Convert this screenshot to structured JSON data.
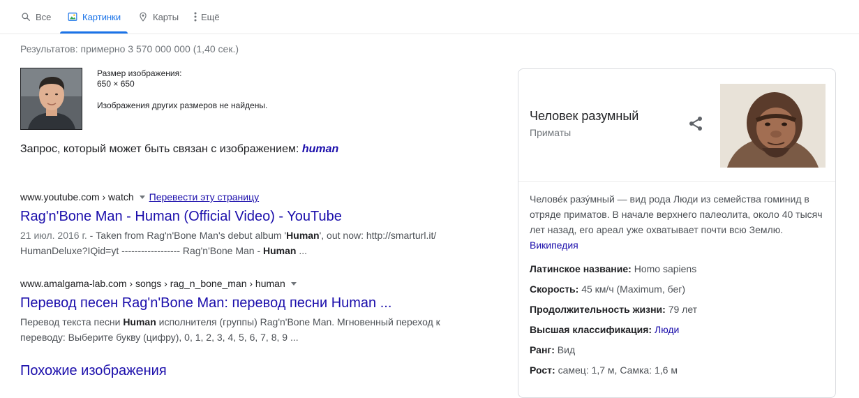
{
  "tabs": [
    {
      "label": "Все",
      "icon": "search-icon"
    },
    {
      "label": "Картинки",
      "icon": "image-icon",
      "active": true
    },
    {
      "label": "Карты",
      "icon": "map-pin-icon"
    },
    {
      "label": "Ещё",
      "icon": "more-vert-icon"
    }
  ],
  "stats": "Результатов: примерно 3 570 000 000 (1,40 сек.)",
  "image_info": {
    "size_label": "Размер изображения:",
    "size_value": "650 × 650",
    "not_found": "Изображения других размеров не найдены."
  },
  "query": {
    "prefix": "Запрос, который может быть связан с изображением: ",
    "term": "human"
  },
  "results": [
    {
      "url": "www.youtube.com › watch",
      "translate": "Перевести эту страницу",
      "title": "Rag'n'Bone Man - Human (Official Video) - YouTube",
      "date": "21 июл. 2016 г.",
      "snippet_a": " - Taken from Rag'n'Bone Man's debut album '",
      "snippet_b": "Human",
      "snippet_c": "', out now: http://smarturl.it/ HumanDeluxe?IQid=yt ------------------ Rag'n'Bone Man - ",
      "snippet_d": "Human",
      "snippet_e": " ..."
    },
    {
      "url": "www.amalgama-lab.com › songs › rag_n_bone_man › human",
      "title": "Перевод песен Rag'n'Bone Man: перевод песни Human ...",
      "snippet_a": "Перевод текста песни ",
      "snippet_b": "Human",
      "snippet_c": " исполнителя (группы) Rag'n'Bone Man. Мгновенный переход к переводу: Выберите букву (цифру), 0, 1, 2, 3, 4, 5, 6, 7, 8, 9 ..."
    }
  ],
  "similar": "Похожие изображения",
  "knowledge_panel": {
    "title": "Человек разумный",
    "subtitle": "Приматы",
    "description": "Челове́к разу́мный — вид рода Люди из семейства гоминид в отряде приматов. В начале верхнего палеолита, около 40 тысяч лет назад, его ареал уже охватывает почти всю Землю.",
    "source": "Википедия",
    "facts": [
      {
        "label": "Латинское название:",
        "value": "Homo sapiens"
      },
      {
        "label": "Скорость:",
        "value": "45 км/ч (Maximum, бег)"
      },
      {
        "label": "Продолжительность жизни:",
        "value": "79 лет"
      },
      {
        "label": "Высшая классификация:",
        "value": "Люди",
        "link": true
      },
      {
        "label": "Ранг:",
        "value": "Вид"
      },
      {
        "label": "Рост:",
        "value": "самец: 1,7 м, Самка: 1,6 м"
      }
    ]
  }
}
